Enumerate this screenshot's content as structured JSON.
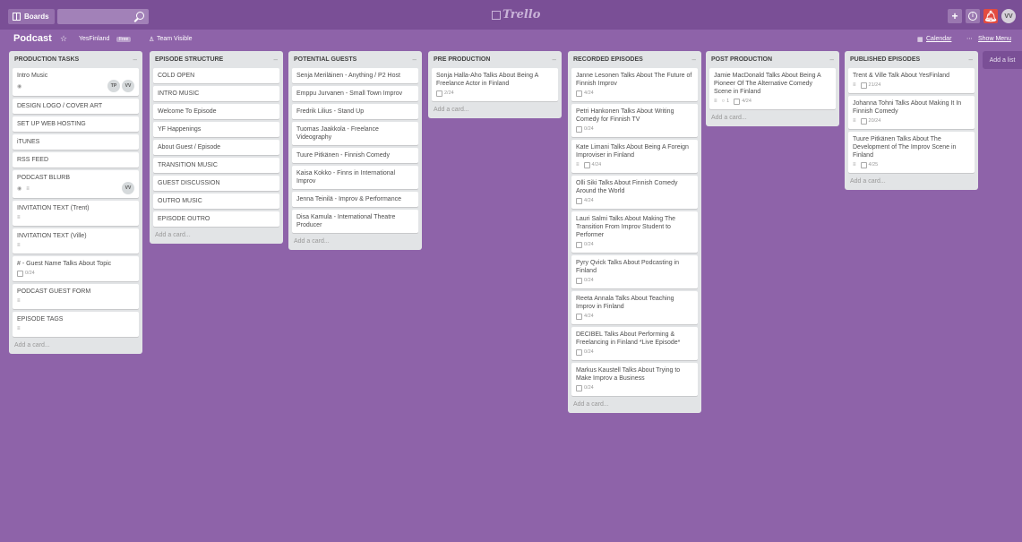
{
  "header": {
    "boards_label": "Boards",
    "search_placeholder": "",
    "logo_text": "Trello",
    "avatar_initials": "VV"
  },
  "board": {
    "title": "Podcast",
    "org": "YesFinland",
    "org_badge": "Free",
    "visibility": "Team Visible",
    "calendar": "Calendar",
    "show_menu": "Show Menu"
  },
  "add_list": "Add a list",
  "add_card": "Add a card...",
  "lists": [
    {
      "title": "PRODUCTION TASKS",
      "cards": [
        {
          "text": "Intro Music",
          "badges": [
            "watch"
          ],
          "members": [
            "TP",
            "VV"
          ]
        },
        {
          "text": "DESIGN LOGO / COVER ART"
        },
        {
          "text": "SET UP WEB HOSTING"
        },
        {
          "text": "iTUNES"
        },
        {
          "text": "RSS FEED"
        },
        {
          "text": "PODCAST BLURB",
          "badges": [
            "watch",
            "desc"
          ],
          "members": [
            "VV"
          ]
        },
        {
          "text": "INVITATION TEXT (Trent)",
          "badges": [
            "desc"
          ]
        },
        {
          "text": "INVITATION TEXT (Ville)",
          "badges": [
            "desc"
          ]
        },
        {
          "text": "# - Guest Name Talks About Topic",
          "checklist": "0/24"
        },
        {
          "text": "PODCAST GUEST FORM",
          "badges": [
            "desc"
          ]
        },
        {
          "text": "EPISODE TAGS",
          "badges": [
            "desc"
          ]
        }
      ]
    },
    {
      "title": "EPISODE STRUCTURE",
      "cards": [
        {
          "text": "COLD OPEN"
        },
        {
          "text": "INTRO MUSIC"
        },
        {
          "text": "Welcome To Episode"
        },
        {
          "text": "YF Happenings"
        },
        {
          "text": "About Guest / Episode"
        },
        {
          "text": "TRANSITION MUSIC"
        },
        {
          "text": "GUEST DISCUSSION"
        },
        {
          "text": "OUTRO MUSIC"
        },
        {
          "text": "EPISODE OUTRO"
        }
      ]
    },
    {
      "title": "POTENTIAL GUESTS",
      "cards": [
        {
          "text": "Senja Meriläinen - Anything / P2 Host"
        },
        {
          "text": "Emppu Jurvanen - Small Town Improv"
        },
        {
          "text": "Fredrik Lilius - Stand Up"
        },
        {
          "text": "Tuomas Jaakkola - Freelance Videography"
        },
        {
          "text": "Tuure Pitkänen - Finnish Comedy"
        },
        {
          "text": "Kaisa Kokko - Finns in International Improv"
        },
        {
          "text": "Jenna Teinilä - Improv & Performance"
        },
        {
          "text": "Disa Kamula - International Theatre Producer"
        }
      ]
    },
    {
      "title": "PRE PRODUCTION",
      "cards": [
        {
          "text": "Sonja Halla-Aho Talks About Being A Freelance Actor in Finland",
          "checklist": "2/24"
        }
      ]
    },
    {
      "title": "RECORDED EPISODES",
      "cards": [
        {
          "text": "Janne Lesonen Talks About The Future of Finnish Improv",
          "checklist": "4/24"
        },
        {
          "text": "Petri Hankonen Talks About Writing Comedy for Finnish TV",
          "checklist": "0/24"
        },
        {
          "text": "Kate Limani Talks About Being A Foreign Improviser in Finland",
          "badges": [
            "desc"
          ],
          "checklist": "4/24"
        },
        {
          "text": "Olli Siki Talks About Finnish Comedy Around the World",
          "checklist": "4/24"
        },
        {
          "text": "Lauri Salmi Talks About Making The Transition From Improv Student to Performer",
          "checklist": "0/24"
        },
        {
          "text": "Pyry Qvick Talks About Podcasting in Finland",
          "checklist": "0/24"
        },
        {
          "text": "Reeta Annala Talks About Teaching Improv in Finland",
          "checklist": "4/24"
        },
        {
          "text": "DECIBEL Talks About Performing & Freelancing in Finland *Live Episode*",
          "checklist": "0/24"
        },
        {
          "text": "Markus Kaustell Talks About Trying to Make Improv a Business",
          "checklist": "0/24"
        }
      ]
    },
    {
      "title": "POST PRODUCTION",
      "cards": [
        {
          "text": "Jamie MacDonald Talks About Being A Pioneer Of The Alternative Comedy Scene in Finland",
          "badges": [
            "desc"
          ],
          "comments": "1",
          "checklist": "4/24"
        }
      ]
    },
    {
      "title": "PUBLISHED EPISODES",
      "cards": [
        {
          "text": "Trent & Ville Talk About YesFinland",
          "badges": [
            "desc"
          ],
          "checklist": "21/24"
        },
        {
          "text": "Johanna Tohni Talks About Making It In Finnish Comedy",
          "badges": [
            "desc"
          ],
          "checklist": "20/24"
        },
        {
          "text": "Tuure Pitkänen Talks About The Development of The Improv Scene in Finland",
          "badges": [
            "desc"
          ],
          "checklist": "4/25"
        }
      ]
    }
  ]
}
